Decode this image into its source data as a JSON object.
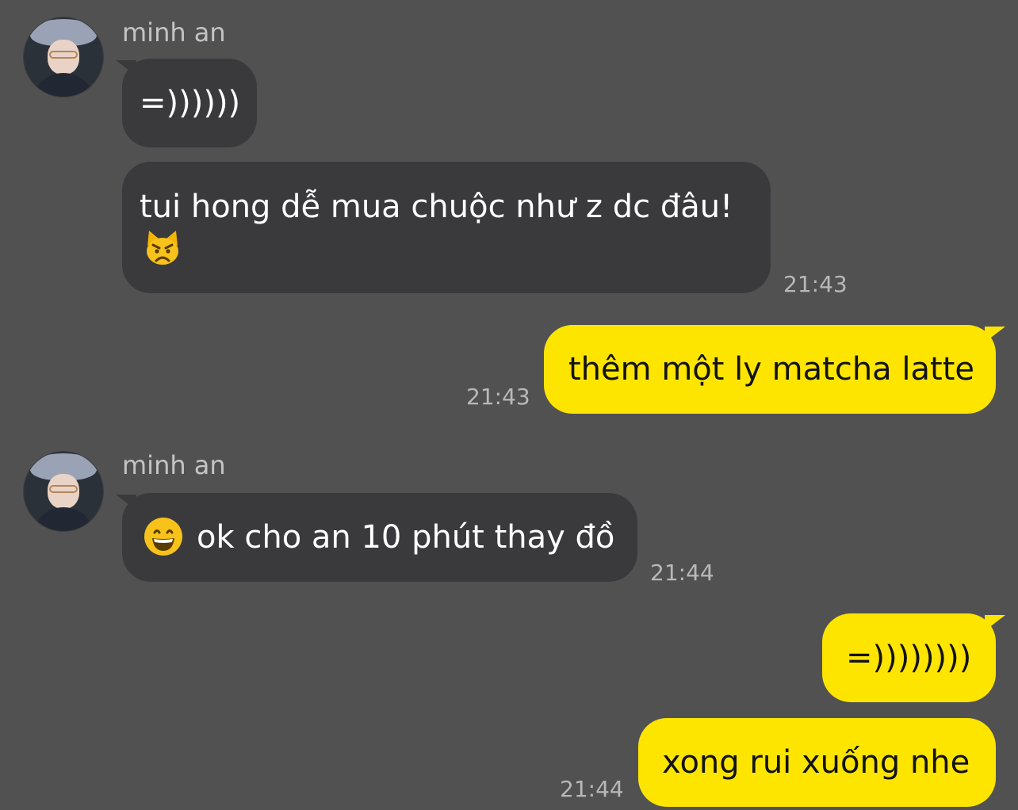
{
  "messages": [
    {
      "sender": "minh an",
      "text": "=))))))"
    },
    {
      "text_line1": "tui hong dễ mua chuộc như z dc đâu!",
      "emoji": "angry-cat",
      "time": "21:43"
    },
    {
      "text": "thêm một ly matcha latte",
      "time": "21:43"
    },
    {
      "sender": "minh an",
      "emoji": "grinning-face",
      "text": "ok cho an 10 phút thay đồ",
      "time": "21:44"
    },
    {
      "text": "=))))))))"
    },
    {
      "text": "xong rui xuống nhe",
      "time": "21:44"
    }
  ],
  "colors": {
    "background": "#525152",
    "incoming_bubble": "#3a393b",
    "outgoing_bubble": "#fde500"
  }
}
